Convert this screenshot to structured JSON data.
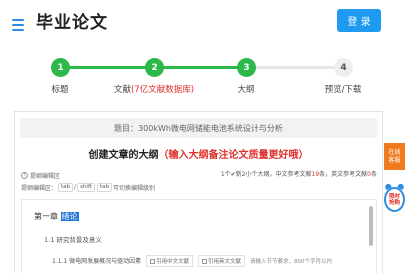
{
  "header": {
    "title": "毕业论文",
    "login_label": "登 录",
    "accent": "#1e9bf0"
  },
  "steps": [
    {
      "num": "1",
      "label": "标题",
      "state": "done"
    },
    {
      "num": "2",
      "label_main": "文献",
      "label_hl": "(7亿文献数据库)",
      "state": "done"
    },
    {
      "num": "3",
      "label": "大纲",
      "state": "active"
    },
    {
      "num": "4",
      "label": "预览/下载",
      "state": "pending"
    }
  ],
  "colors": {
    "step_done": "#2db84a",
    "step_pending": "#e6e6e6",
    "highlight": "#e0302b",
    "float_orange": "#f07a1f"
  },
  "topic": {
    "text": "题目：300kWh微电网储能电池系统设计与分析"
  },
  "outline_heading": {
    "main": "创建文章的大纲",
    "red": "（输入大纲备注论文质量更好哦）"
  },
  "editor_head": {
    "area_label": "提纲编辑区",
    "shortcut_prefix": "提纲编辑区：",
    "key_tab": "tab",
    "key_shift": "shift",
    "key_tab2": "tab",
    "shortcut_suffix": "可切换编辑级别",
    "stats": {
      "pre": "1个✔新2小个大纲，中文参考文献",
      "cn_refs": "19",
      "mid": "条，英文参考文献",
      "en_refs": "0",
      "post": "条"
    }
  },
  "outline": {
    "chapter_prefix": "第一章",
    "chapter_selected": "绪论",
    "section": "1.1 研究背景及意义",
    "subsection": "1.1.1 微电网发展概况与驱动因素",
    "chip_cn": "引用中文文献",
    "chip_en": "引用英文文献",
    "hint": "请输入节节要求，800个字符以内"
  },
  "floating": {
    "online_line1": "在线",
    "online_line2": "客服",
    "promo_line1": "限时",
    "promo_line2": "抢购"
  }
}
